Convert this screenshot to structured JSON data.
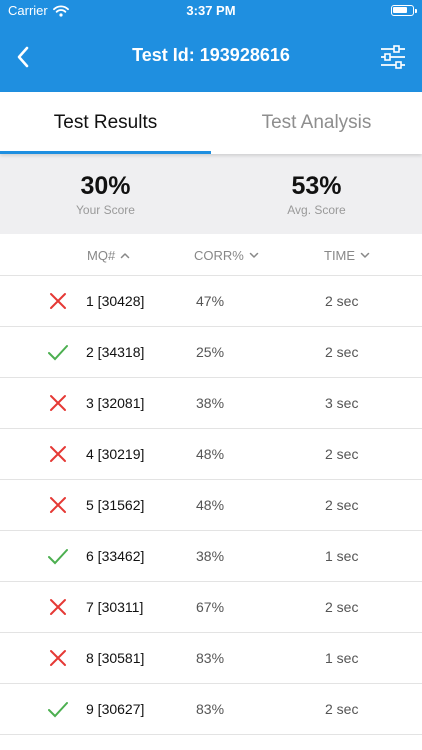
{
  "status_bar": {
    "carrier": "Carrier",
    "time": "3:37 PM"
  },
  "nav": {
    "title": "Test Id: 193928616",
    "back_icon": "chevron-left-icon",
    "filter_icon": "sliders-icon"
  },
  "tabs": [
    {
      "label": "Test Results",
      "active": true
    },
    {
      "label": "Test Analysis",
      "active": false
    }
  ],
  "scores": {
    "your": {
      "value": "30%",
      "label": "Your Score"
    },
    "avg": {
      "value": "53%",
      "label": "Avg. Score"
    }
  },
  "table": {
    "headers": {
      "mq": "MQ#",
      "corr": "CORR%",
      "time": "TIME"
    },
    "rows": [
      {
        "correct": false,
        "mq": "1 [30428]",
        "corr": "47%",
        "time": "2 sec"
      },
      {
        "correct": true,
        "mq": "2 [34318]",
        "corr": "25%",
        "time": "2 sec"
      },
      {
        "correct": false,
        "mq": "3 [32081]",
        "corr": "38%",
        "time": "3 sec"
      },
      {
        "correct": false,
        "mq": "4 [30219]",
        "corr": "48%",
        "time": "2 sec"
      },
      {
        "correct": false,
        "mq": "5 [31562]",
        "corr": "48%",
        "time": "2 sec"
      },
      {
        "correct": true,
        "mq": "6 [33462]",
        "corr": "38%",
        "time": "1 sec"
      },
      {
        "correct": false,
        "mq": "7 [30311]",
        "corr": "67%",
        "time": "2 sec"
      },
      {
        "correct": false,
        "mq": "8 [30581]",
        "corr": "83%",
        "time": "1 sec"
      },
      {
        "correct": true,
        "mq": "9 [30627]",
        "corr": "83%",
        "time": "2 sec"
      }
    ]
  },
  "colors": {
    "accent": "#1f8fe0",
    "correct": "#4caf50",
    "incorrect": "#e53935"
  }
}
